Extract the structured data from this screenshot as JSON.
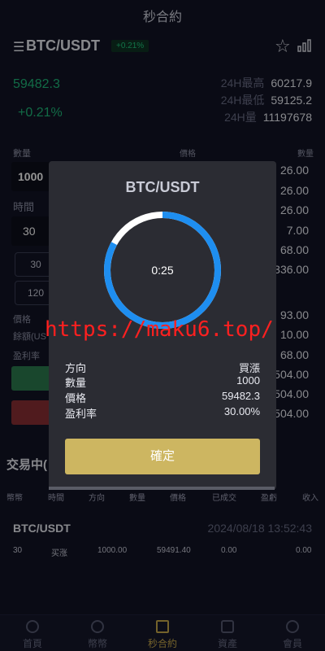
{
  "header": {
    "title": "秒合約"
  },
  "pair": {
    "name": "BTC/USDT",
    "change_badge": "+0.21%"
  },
  "price": {
    "last": "59482.3",
    "change_pct": "+0.21%"
  },
  "stats": [
    {
      "label": "24H最高",
      "value": "60217.9"
    },
    {
      "label": "24H最低",
      "value": "59125.2"
    },
    {
      "label": "24H量",
      "value": "11197678"
    }
  ],
  "form": {
    "qty_label": "數量",
    "qty_value": "1000",
    "time_label": "時間",
    "time_value": "30",
    "options": [
      "30",
      "120"
    ],
    "price_label": "價格",
    "balance_label": "餘額(US",
    "profit_label": "盈利率"
  },
  "book": {
    "price_header": "價格",
    "qty_header": "數量",
    "values_top": [
      "26.00",
      "26.00",
      "26.00",
      "7.00",
      "68.00",
      "336.00"
    ],
    "values_bottom": [
      "93.00",
      "10.00",
      "68.00",
      "504.00",
      "504.00",
      "504.00"
    ]
  },
  "trading": {
    "title": "交易中(",
    "headers": [
      "幣幣",
      "時間",
      "方向",
      "數量",
      "價格",
      "已成交",
      "盈虧",
      "收入"
    ],
    "order": {
      "pair": "BTC/USDT",
      "datetime": "2024/08/18 13:52:43",
      "time": "30",
      "direction": "买涨",
      "qty": "1000.00",
      "price": "59491.40",
      "filled": "0.00",
      "pnl": "",
      "income": "0.00"
    }
  },
  "tabs": [
    {
      "label": "首頁",
      "icon": "home-icon"
    },
    {
      "label": "幣幣",
      "icon": "coin-icon"
    },
    {
      "label": "秒合約",
      "icon": "chart-bars-icon"
    },
    {
      "label": "資產",
      "icon": "wallet-icon"
    },
    {
      "label": "會員",
      "icon": "user-icon"
    }
  ],
  "modal": {
    "title": "BTC/USDT",
    "countdown": "0:25",
    "countdown_progress": 0.83,
    "rows": [
      {
        "label": "方向",
        "value": "買漲"
      },
      {
        "label": "數量",
        "value": "1000"
      },
      {
        "label": "價格",
        "value": "59482.3"
      },
      {
        "label": "盈利率",
        "value": "30.00%"
      }
    ],
    "confirm_label": "確定"
  },
  "watermark": "https://maku6.top/",
  "colors": {
    "accent": "#c9a94b",
    "up": "#1fb879",
    "ring": "#1e8ef0",
    "confirm": "#cdb661"
  }
}
